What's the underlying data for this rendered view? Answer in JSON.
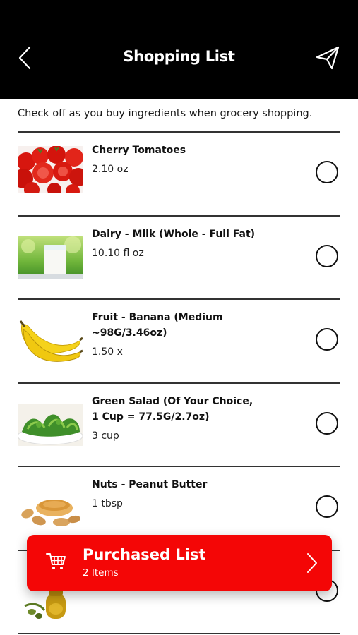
{
  "header": {
    "title": "Shopping List",
    "back_icon": "chevron-left-icon",
    "send_icon": "paper-plane-icon"
  },
  "instructions": "Check off as you buy ingredients when grocery shopping.",
  "items": [
    {
      "name": "Cherry Tomatoes",
      "quantity": "2.10 oz",
      "image": "cherry-tomatoes",
      "checked": false
    },
    {
      "name": "Dairy - Milk (Whole - Full Fat)",
      "quantity": "10.10 fl oz",
      "image": "milk-glass",
      "checked": false
    },
    {
      "name": "Fruit - Banana (Medium ~98G/3.46oz)",
      "quantity": "1.50 x",
      "image": "bananas",
      "checked": false
    },
    {
      "name": "Green Salad (Of Your Choice, 1 Cup = 77.5G/2.7oz)",
      "quantity": "3 cup",
      "image": "green-salad",
      "checked": false
    },
    {
      "name": "Nuts - Peanut Butter",
      "quantity": "1 tbsp",
      "image": "peanut-butter",
      "checked": false
    },
    {
      "image": "olive-oil",
      "checked": false
    }
  ],
  "purchased": {
    "title": "Purchased List",
    "count": "2 Items",
    "icon": "shopping-cart-icon"
  },
  "colors": {
    "header_bg": "#000000",
    "accent": "#f40606",
    "divider": "#333333"
  }
}
